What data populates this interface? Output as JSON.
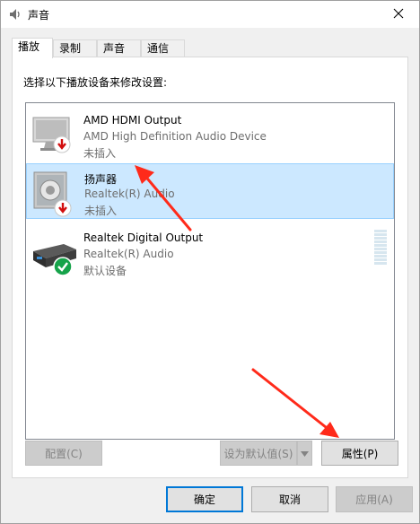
{
  "window": {
    "title": "声音",
    "close_icon": "close-icon",
    "title_icon": "speaker-icon"
  },
  "tabs": [
    {
      "label": "播放",
      "active": true
    },
    {
      "label": "录制",
      "active": false
    },
    {
      "label": "声音",
      "active": false
    },
    {
      "label": "通信",
      "active": false
    }
  ],
  "panel": {
    "instruction": "选择以下播放设备来修改设置:"
  },
  "devices": [
    {
      "name": "AMD HDMI Output",
      "description": "AMD High Definition Audio Device",
      "status": "未插入",
      "icon": "monitor-icon",
      "badge": "unplugged-icon",
      "selected": false
    },
    {
      "name": "扬声器",
      "description": "Realtek(R) Audio",
      "status": "未插入",
      "icon": "speaker-icon",
      "badge": "unplugged-icon",
      "selected": true
    },
    {
      "name": "Realtek Digital Output",
      "description": "Realtek(R) Audio",
      "status": "默认设备",
      "icon": "receiver-icon",
      "badge": "default-check-icon",
      "selected": false
    }
  ],
  "buttons": {
    "configure": "配置(C)",
    "set_default": "设为默认值(S)",
    "properties": "属性(P)",
    "ok": "确定",
    "cancel": "取消",
    "apply": "应用(A)"
  },
  "colors": {
    "selection_bg": "#cce8ff",
    "selection_border": "#99d1ff",
    "annotation_arrow": "#ff2a1a",
    "default_button_border": "#0078d7"
  }
}
